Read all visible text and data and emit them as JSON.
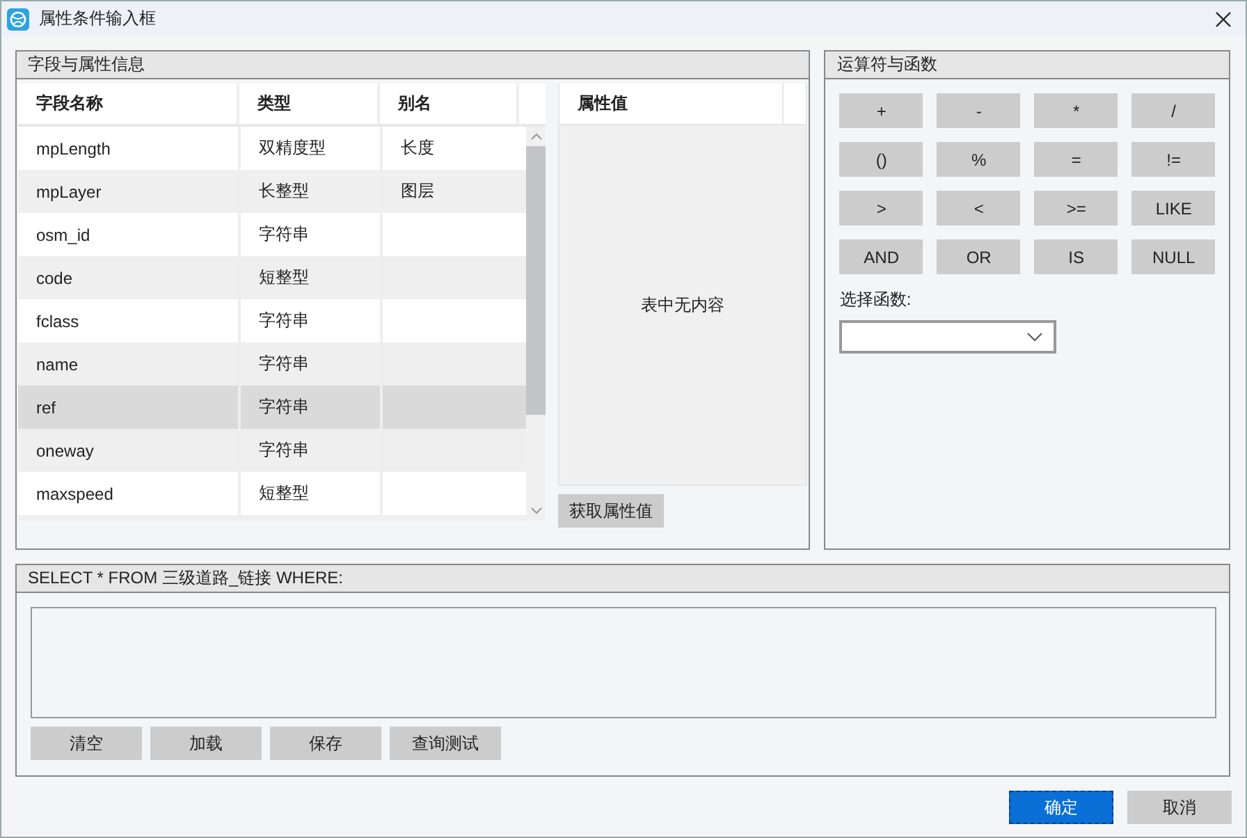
{
  "window": {
    "title": "属性条件输入框"
  },
  "fields_group": {
    "title": "字段与属性信息",
    "columns": [
      "字段名称",
      "类型",
      "别名"
    ],
    "rows": [
      {
        "name": "mpLength",
        "type": "双精度型",
        "alias": "长度",
        "selected": false
      },
      {
        "name": "mpLayer",
        "type": "长整型",
        "alias": "图层",
        "selected": false
      },
      {
        "name": "osm_id",
        "type": "字符串",
        "alias": "",
        "selected": false
      },
      {
        "name": "code",
        "type": "短整型",
        "alias": "",
        "selected": false
      },
      {
        "name": "fclass",
        "type": "字符串",
        "alias": "",
        "selected": false
      },
      {
        "name": "name",
        "type": "字符串",
        "alias": "",
        "selected": false
      },
      {
        "name": "ref",
        "type": "字符串",
        "alias": "",
        "selected": true
      },
      {
        "name": "oneway",
        "type": "字符串",
        "alias": "",
        "selected": false
      },
      {
        "name": "maxspeed",
        "type": "短整型",
        "alias": "",
        "selected": false
      }
    ],
    "values_column": "属性值",
    "empty_text": "表中无内容",
    "get_values_button": "获取属性值"
  },
  "operators_group": {
    "title": "运算符与函数",
    "operators": [
      "+",
      "-",
      "*",
      "/",
      "()",
      "%",
      "=",
      "!=",
      ">",
      "<",
      ">=",
      "LIKE",
      "AND",
      "OR",
      "IS",
      "NULL"
    ],
    "function_label": "选择函数:"
  },
  "query_group": {
    "title": "SELECT * FROM 三级道路_链接 WHERE:",
    "buttons": [
      "清空",
      "加载",
      "保存",
      "查询测试"
    ]
  },
  "dialog_buttons": [
    {
      "label": "确定",
      "kind": "primary"
    },
    {
      "label": "取消",
      "kind": "secondary"
    }
  ]
}
